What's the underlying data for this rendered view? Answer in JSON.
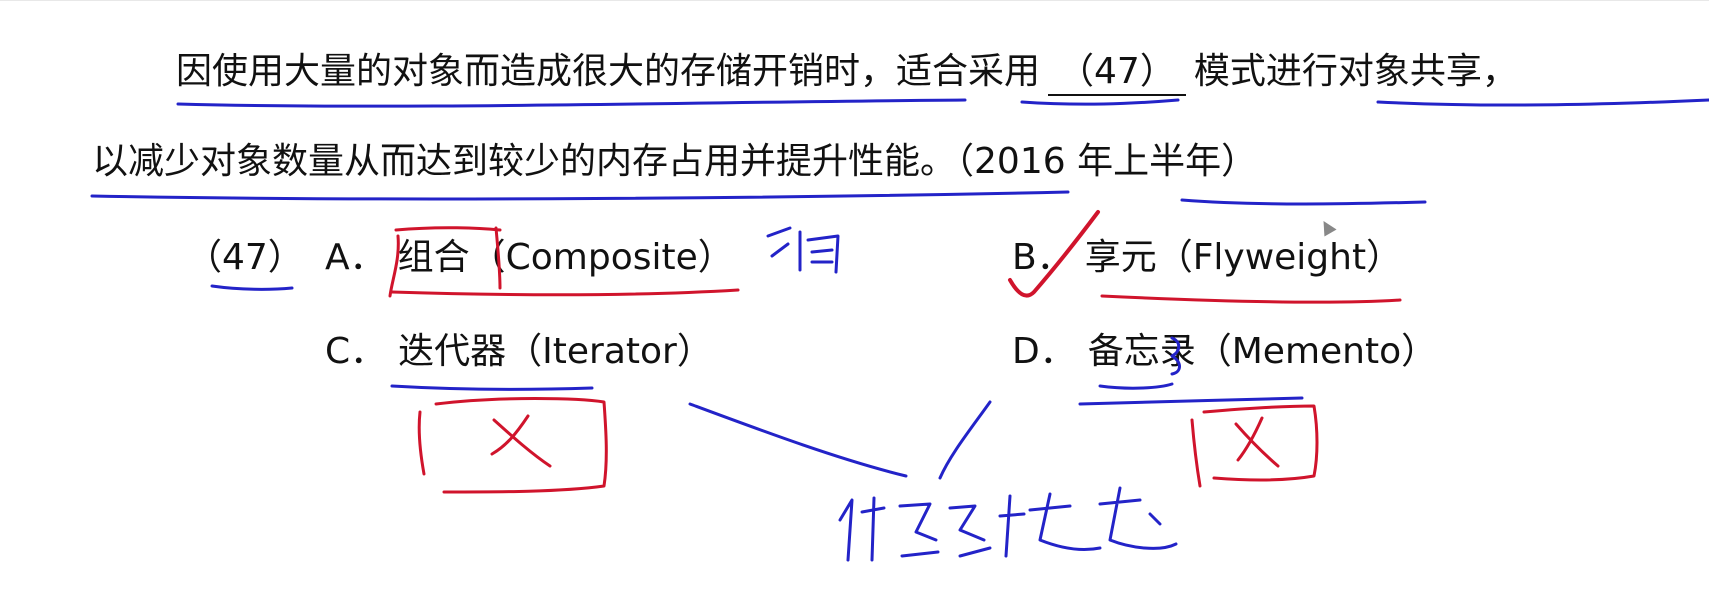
{
  "question": {
    "line1_part1": "因使用大量的对象而造成很大的存储开销时，",
    "line1_part2": "适合采用",
    "blank": "（47）",
    "line1_part3": "模式进行对象共享，",
    "line2": "以减少对象数量从而达到较少的内存占用并提升性能。",
    "source": "（2016 年上半年）"
  },
  "options": {
    "number": "（47）",
    "a": {
      "letter": "A．",
      "text": "组合（Composite）"
    },
    "b": {
      "letter": "B．",
      "text": "享元（Flyweight）"
    },
    "c": {
      "letter": "C．",
      "text": "迭代器（Iterator）"
    },
    "d": {
      "letter": "D．",
      "text": "备忘录（Memento）"
    }
  },
  "annotations": {
    "ink_colors": {
      "blue": "#2323c8",
      "red": "#d0142c"
    }
  }
}
